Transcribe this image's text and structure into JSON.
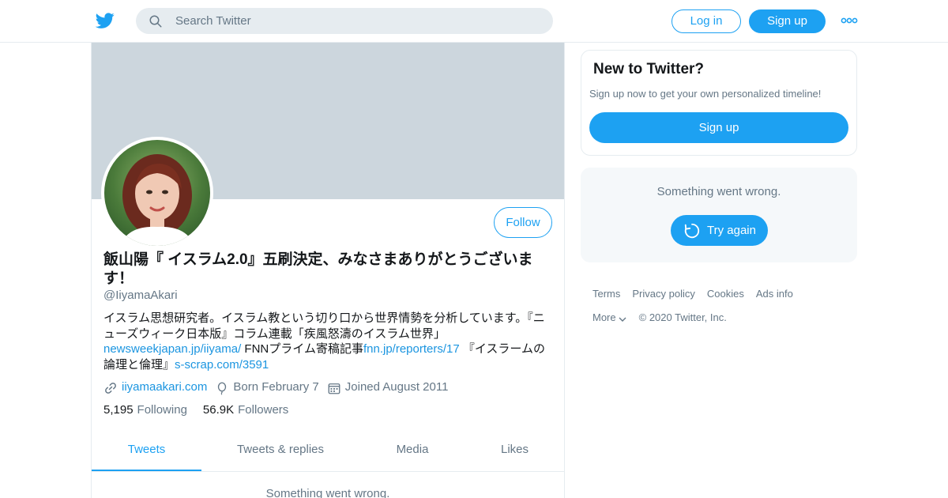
{
  "header": {
    "search_placeholder": "Search Twitter",
    "login_label": "Log in",
    "signup_label": "Sign up"
  },
  "profile": {
    "display_name": "飯山陽『 イスラム2.0』五刷決定、みなさまありがとうございます！",
    "handle": "@IiyamaAkari",
    "follow_label": "Follow",
    "bio": {
      "text1": "イスラム思想研究者。イスラム教という切り口から世界情勢を分析しています。『ニューズウィーク日本版』コラム連載「疾風怒濤のイスラム世界」",
      "link1": "newsweekjapan.jp/iiyama/",
      "text2": " FNNプライム寄稿記事",
      "link2": "fnn.jp/reporters/17",
      "text3": " 『イスラームの論理と倫理』",
      "link3": "s-scrap.com/3591"
    },
    "website": "iiyamaakari.com",
    "birthday": "Born February 7",
    "joined": "Joined August 2011",
    "following_count": "5,195",
    "following_label": "Following",
    "followers_count": "56.9K",
    "followers_label": "Followers",
    "tabs": [
      "Tweets",
      "Tweets & replies",
      "Media",
      "Likes"
    ],
    "timeline_error": "Something went wrong."
  },
  "sidebar": {
    "new_title": "New to Twitter?",
    "new_subtitle": "Sign up now to get your own personalized timeline!",
    "signup_label": "Sign up",
    "error_text": "Something went wrong.",
    "try_again_label": "Try again",
    "footer": {
      "terms": "Terms",
      "privacy": "Privacy policy",
      "cookies": "Cookies",
      "ads": "Ads info",
      "more": "More",
      "copyright": "© 2020 Twitter, Inc."
    }
  },
  "colors": {
    "brand": "#1da1f2",
    "banner": "#ccd6dd",
    "muted_text": "#657786"
  }
}
